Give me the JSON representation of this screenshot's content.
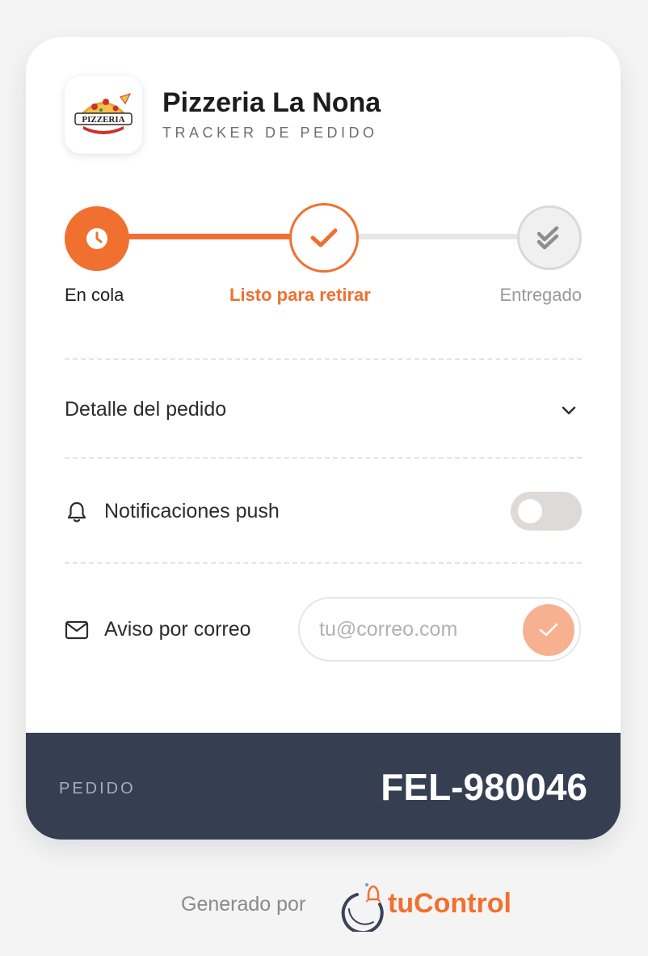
{
  "header": {
    "title": "Pizzeria La Nona",
    "subtitle": "TRACKER DE PEDIDO",
    "logo_text": "PIZZERIA"
  },
  "stepper": {
    "steps": [
      {
        "label": "En cola",
        "icon": "clock-icon",
        "state": "done"
      },
      {
        "label": "Listo para retirar",
        "icon": "check-icon",
        "state": "current"
      },
      {
        "label": "Entregado",
        "icon": "double-check-icon",
        "state": "pending"
      }
    ],
    "colors": {
      "active": "#f07030",
      "pending": "#e6e6e6"
    }
  },
  "detail": {
    "label": "Detalle del pedido",
    "icon": "chevron-down-icon"
  },
  "push": {
    "label": "Notificaciones push",
    "icon": "bell-icon",
    "enabled": false
  },
  "email": {
    "label": "Aviso por correo",
    "icon": "mail-icon",
    "placeholder": "tu@correo.com",
    "value": "",
    "submit_icon": "check-icon"
  },
  "order": {
    "label": "PEDIDO",
    "number": "FEL-980046",
    "band_color": "#363f52"
  },
  "footer": {
    "generated_by": "Generado por",
    "brand_part1": "tu",
    "brand_part2": "Control",
    "brand_color": "#f07030"
  }
}
